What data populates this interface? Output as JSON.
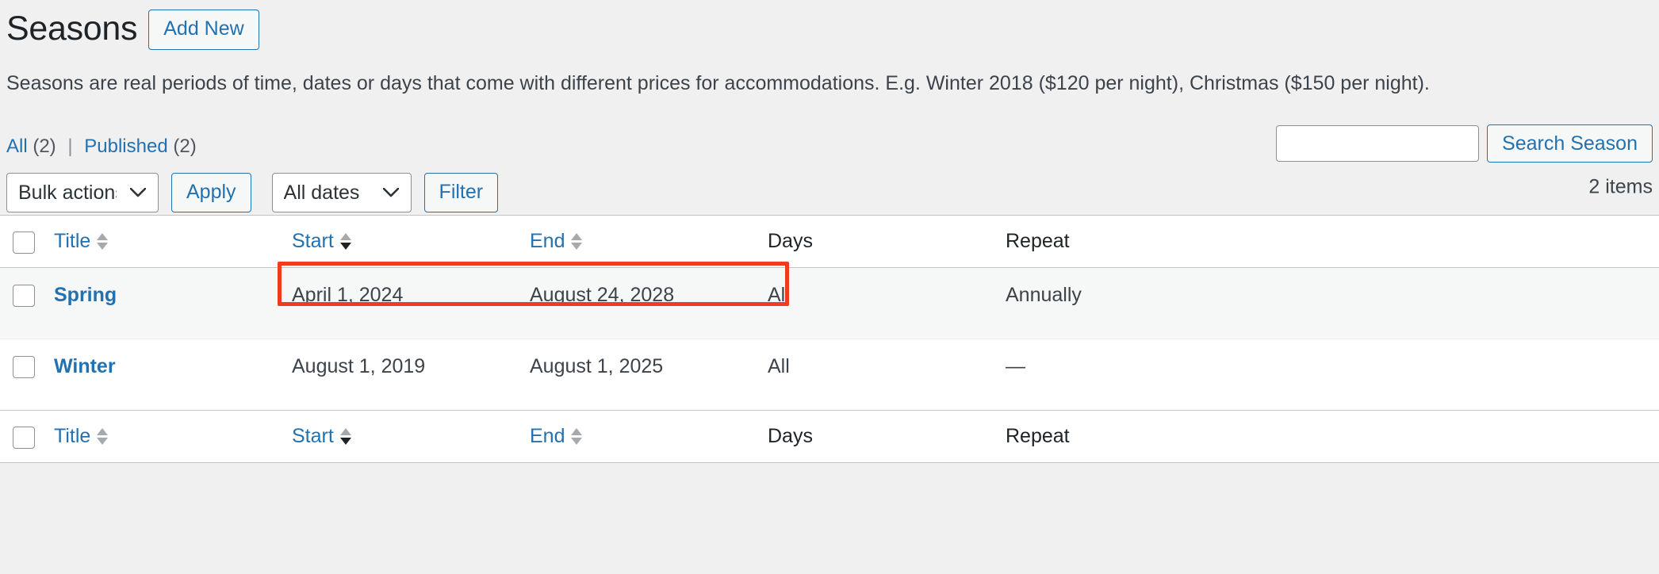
{
  "header": {
    "title": "Seasons",
    "add_new_label": "Add New"
  },
  "description": "Seasons are real periods of time, dates or days that come with different prices for accommodations. E.g. Winter 2018 ($120 per night), Christmas ($150 per night).",
  "status_links": [
    {
      "label": "All",
      "count": "(2)"
    },
    {
      "label": "Published",
      "count": "(2)"
    }
  ],
  "separator": "|",
  "search": {
    "value": "",
    "placeholder": "",
    "button_label": "Search Season"
  },
  "tablenav": {
    "bulk_actions_selected": "Bulk actions",
    "bulk_actions_options": [
      "Bulk actions"
    ],
    "apply_label": "Apply",
    "dates_selected": "All dates",
    "dates_options": [
      "All dates"
    ],
    "filter_label": "Filter",
    "displaying_num": "2 items"
  },
  "table": {
    "columns": [
      {
        "key": "cb",
        "label": "",
        "sortable": false
      },
      {
        "key": "title",
        "label": "Title",
        "sortable": true,
        "sort_state": "none"
      },
      {
        "key": "start",
        "label": "Start",
        "sortable": true,
        "sort_state": "desc"
      },
      {
        "key": "end",
        "label": "End",
        "sortable": true,
        "sort_state": "none"
      },
      {
        "key": "days",
        "label": "Days",
        "sortable": false
      },
      {
        "key": "repeat",
        "label": "Repeat",
        "sortable": false
      }
    ],
    "rows": [
      {
        "title": "Spring",
        "start": "April 1, 2024",
        "end": "August 24, 2028",
        "days": "All",
        "repeat": "Annually"
      },
      {
        "title": "Winter",
        "start": "August 1, 2019",
        "end": "August 1, 2025",
        "days": "All",
        "repeat": "—"
      }
    ]
  },
  "annotation": {
    "color": "#ef3b22",
    "target": "start-and-end-column-headers"
  }
}
